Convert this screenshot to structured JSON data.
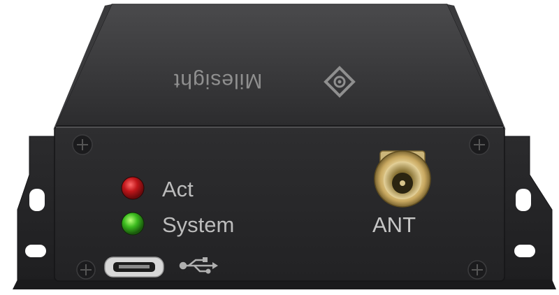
{
  "device": {
    "brand": "Milesight",
    "indicators": [
      {
        "label": "Act",
        "color": "#c0161a"
      },
      {
        "label": "System",
        "color": "#3bbb1e"
      }
    ],
    "antenna_label": "ANT",
    "ports": [
      "micro-usb-port"
    ],
    "icons": [
      "usb-icon",
      "milesight-logo-icon"
    ]
  }
}
